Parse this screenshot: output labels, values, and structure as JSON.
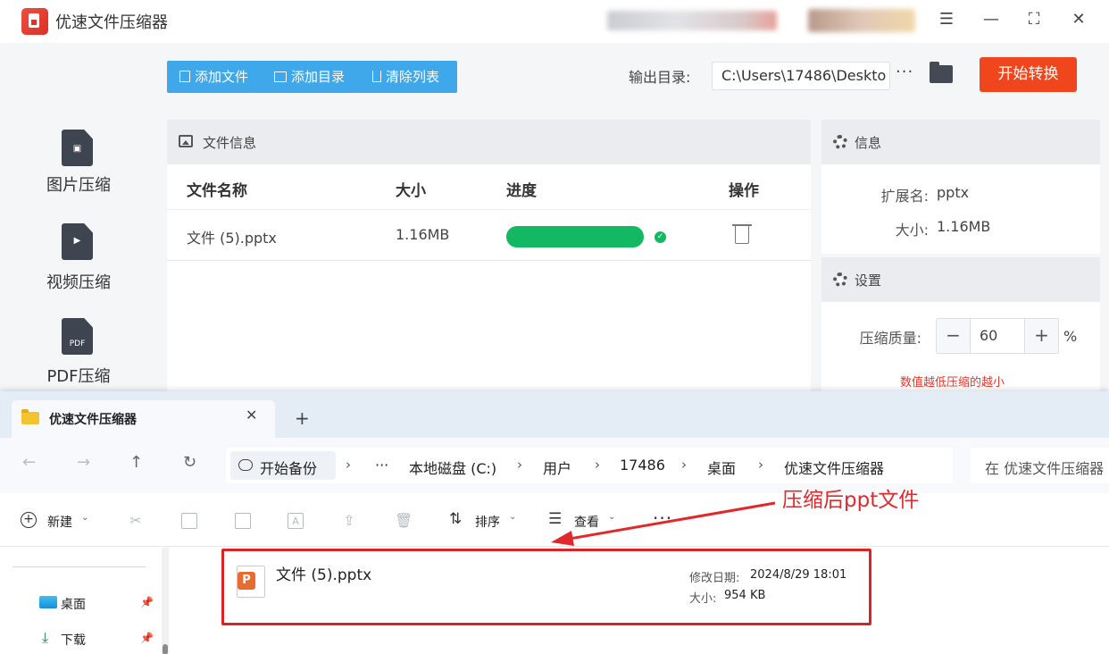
{
  "app": {
    "title": "优速文件压缩器",
    "window_controls": [
      "menu",
      "minimize",
      "maximize",
      "close"
    ]
  },
  "sidebar": {
    "items": [
      {
        "label": "图片压缩",
        "icon": "image-file-icon"
      },
      {
        "label": "视频压缩",
        "icon": "video-file-icon"
      },
      {
        "label": "PDF压缩",
        "icon": "pdf-file-icon",
        "glyph": "PDF"
      }
    ]
  },
  "toolbar": {
    "add_file": "添加文件",
    "add_dir": "添加目录",
    "clear_list": "清除列表",
    "output_label": "输出目录:",
    "output_path": "C:\\Users\\17486\\Deskto",
    "more": "···",
    "start": "开始转换"
  },
  "file_panel": {
    "title": "文件信息",
    "columns": [
      "文件名称",
      "大小",
      "进度",
      "操作"
    ],
    "rows": [
      {
        "name": "文件 (5).pptx",
        "size": "1.16MB",
        "progress": 1.0,
        "status": "done"
      }
    ]
  },
  "info_panel": {
    "title": "信息",
    "ext_key": "扩展名:",
    "ext_val": "pptx",
    "size_key": "大小:",
    "size_val": "1.16MB"
  },
  "settings_panel": {
    "title": "设置",
    "quality_label": "压缩质量:",
    "minus": "−",
    "value": "60",
    "plus": "+",
    "unit": "%",
    "hint": "数值越低压缩的越小"
  },
  "explorer": {
    "tab_label": "优速文件压缩器",
    "tab_close": "✕",
    "new_tab": "+",
    "backup_label": "开始备份",
    "breadcrumbs": [
      "本地磁盘 (C:)",
      "用户",
      "17486",
      "桌面",
      "优速文件压缩器"
    ],
    "breadcrumb_more": "···",
    "search_placeholder": "在 优速文件压缩器",
    "cmd": {
      "new": "新建",
      "sort": "排序",
      "view": "查看",
      "more": "···"
    },
    "quick_access": [
      {
        "label": "桌面"
      },
      {
        "label": "下载"
      }
    ],
    "file": {
      "name": "文件 (5).pptx",
      "modified_key": "修改日期:",
      "modified_val": "2024/8/29 18:01",
      "size_key": "大小:",
      "size_val": "954 KB"
    }
  },
  "annotation": {
    "text": "压缩后ppt文件"
  },
  "colors": {
    "accent_blue": "#3ea8ea",
    "start_orange": "#f0461e",
    "progress_green": "#12b862",
    "highlight_red": "#d92426"
  }
}
